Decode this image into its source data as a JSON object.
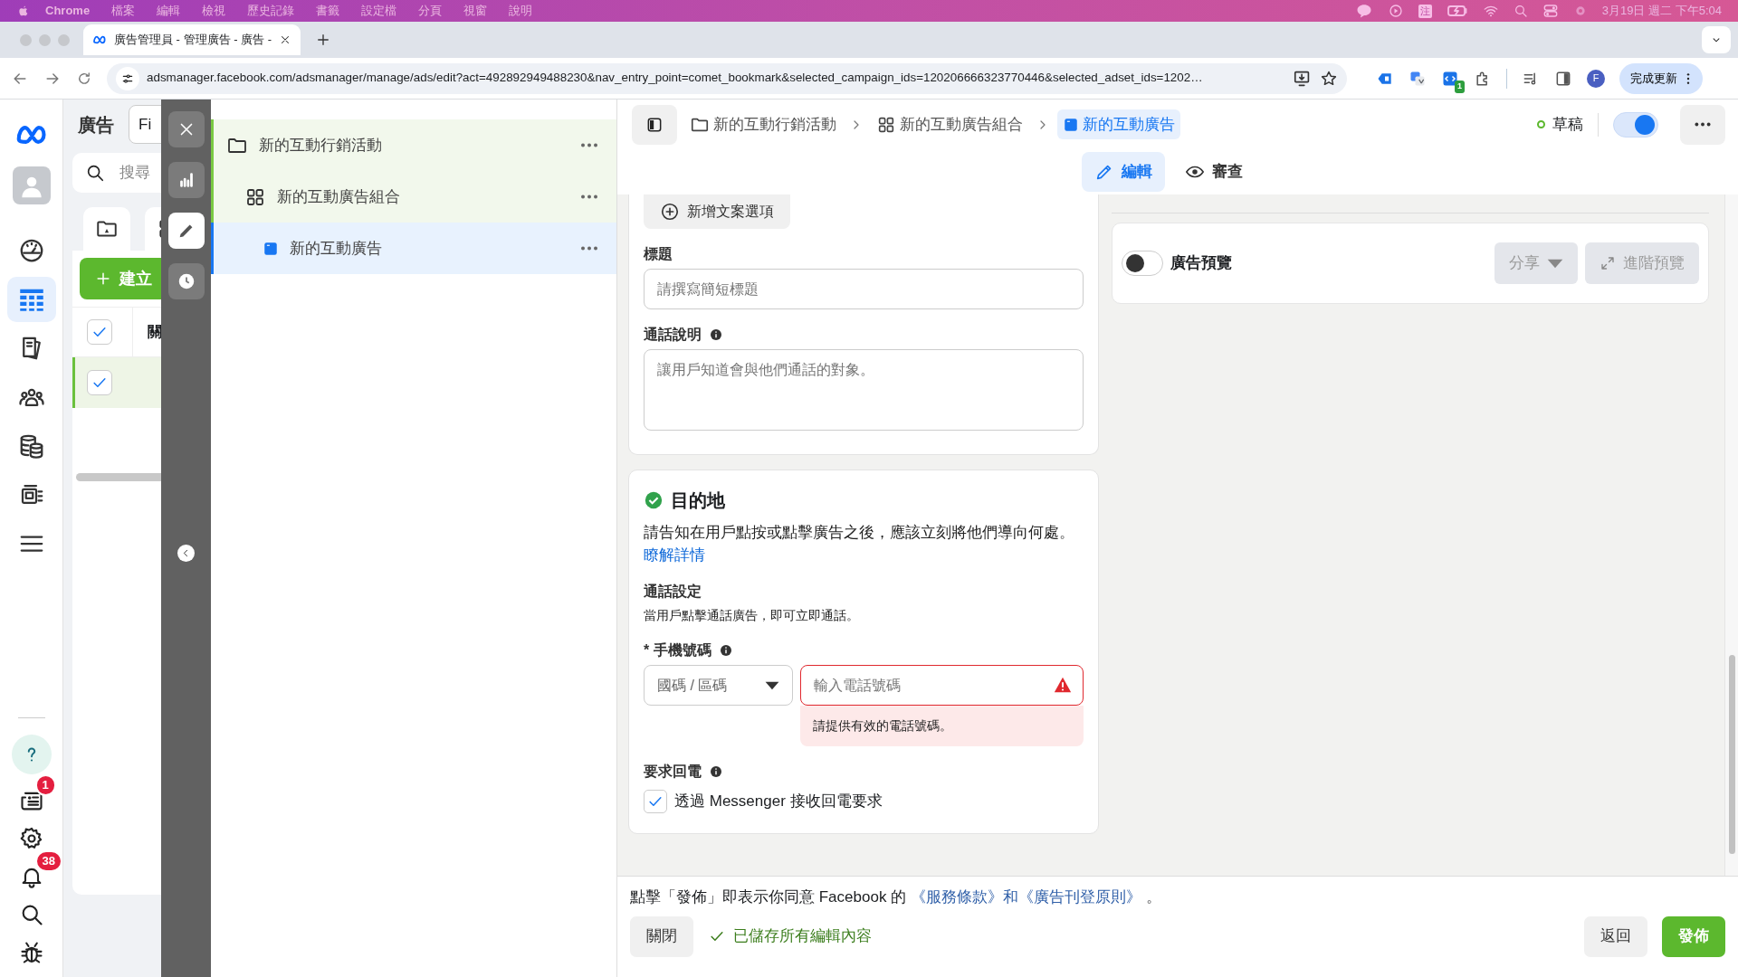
{
  "menu_bar": {
    "app": "Chrome",
    "items": [
      "檔案",
      "編輯",
      "檢視",
      "歷史記錄",
      "書籤",
      "設定檔",
      "分頁",
      "視窗",
      "說明"
    ],
    "input_method": "注",
    "clock": "3月19日 週二 下午5:04"
  },
  "browser": {
    "tab_title": "廣告管理員 - 管理廣告 - 廣告 -",
    "url": "adsmanager.facebook.com/adsmanager/manage/ads/edit?act=492892949488230&nav_entry_point=comet_bookmark&selected_campaign_ids=120206666323770446&selected_adset_ids=1202…",
    "extension_badge": "1",
    "profile_initial": "F",
    "update_button": "完成更新"
  },
  "nav": {
    "items": [
      {
        "kind": "gauge",
        "selected": false
      },
      {
        "kind": "table",
        "selected": true
      },
      {
        "kind": "pages",
        "selected": false
      },
      {
        "kind": "people",
        "selected": false
      },
      {
        "kind": "coins",
        "selected": false
      },
      {
        "kind": "gallery",
        "selected": false
      },
      {
        "kind": "menu",
        "selected": false
      }
    ],
    "bottom_items": [
      {
        "kind": "help"
      },
      {
        "kind": "news",
        "badge": "1"
      },
      {
        "kind": "gear"
      },
      {
        "kind": "bell",
        "badge": "38"
      },
      {
        "kind": "search"
      },
      {
        "kind": "bug"
      }
    ]
  },
  "ads_panel": {
    "title": "廣告",
    "filter": "Fi",
    "search_placeholder": "搜尋",
    "create_button": "建立",
    "column_header": "關",
    "header_checked": true,
    "rows": [
      {
        "checked": true
      }
    ]
  },
  "tool_strip": [
    {
      "kind": "close",
      "selected": false
    },
    {
      "kind": "chart",
      "selected": false
    },
    {
      "kind": "edit",
      "selected": true
    },
    {
      "kind": "history",
      "selected": false
    }
  ],
  "tree": [
    {
      "kind": "campaign",
      "label": "新的互動行銷活動",
      "selected": false,
      "children": [
        {
          "kind": "adset",
          "label": "新的互動廣告組合",
          "selected": false,
          "children": [
            {
              "kind": "ad",
              "label": "新的互動廣告",
              "selected": true
            }
          ]
        }
      ]
    }
  ],
  "breadcrumb": [
    {
      "kind": "campaign",
      "label": "新的互動行銷活動",
      "selected": false
    },
    {
      "kind": "adset",
      "label": "新的互動廣告組合",
      "selected": false
    },
    {
      "kind": "ad",
      "label": "新的互動廣告",
      "selected": true
    }
  ],
  "status": {
    "label": "草稿",
    "on": true
  },
  "view_tabs": [
    {
      "kind": "edit",
      "label": "編輯",
      "selected": true
    },
    {
      "kind": "review",
      "label": "審查",
      "selected": false
    }
  ],
  "form": {
    "add_text_option": "新增文案選項",
    "headline": {
      "label": "標題",
      "placeholder": "請撰寫簡短標題"
    },
    "call_description": {
      "label": "通話說明",
      "placeholder": "讓用戶知道會與他們通話的對象。"
    },
    "destination": {
      "title": "目的地",
      "complete": true,
      "description": "請告知在用戶點按或點擊廣告之後，應該立刻將他們導向何處。",
      "link": "瞭解詳情",
      "call_settings_title": "通話設定",
      "call_settings_text": "當用戶點擊通話廣告，即可立即通話。",
      "phone_label": "* 手機號碼",
      "country_placeholder": "國碼 / 區碼",
      "phone_placeholder": "輸入電話號碼",
      "error": "請提供有效的電話號碼。",
      "callback_label": "要求回電",
      "callback_option": {
        "label": "透過 Messenger 接收回電要求",
        "checked": true
      }
    }
  },
  "preview": {
    "label": "廣告預覽",
    "on": false,
    "share": "分享",
    "advanced": "進階預覽"
  },
  "footer": {
    "terms": "點擊「發佈」即表示你同意 Facebook 的",
    "terms_link": "《服務條款》和《廣告刊登原則》",
    "terms_end": "。",
    "close": "關閉",
    "saved": "已儲存所有編輯內容",
    "back": "返回",
    "publish": "發佈"
  }
}
